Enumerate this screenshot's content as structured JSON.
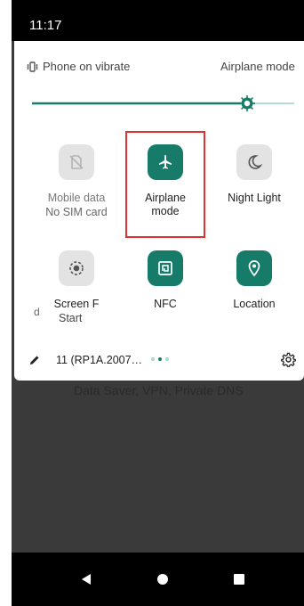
{
  "status_bar": {
    "time": "11:17"
  },
  "quick_settings": {
    "ringer_label": "Phone on vibrate",
    "airplane_header_label": "Airplane mode",
    "brightness_fraction": 0.82,
    "accent_color": "#167b68",
    "tiles": [
      {
        "label": "Mobile data",
        "sublabel": "No SIM card",
        "state": "off",
        "icon": "no-sim-icon"
      },
      {
        "label": "Airplane",
        "sublabel": "mode",
        "state": "on",
        "icon": "airplane-icon"
      },
      {
        "label": "Night Light",
        "sublabel": "",
        "state": "off",
        "icon": "moon-icon"
      },
      {
        "label": "Screen F",
        "sublabel": "Start",
        "state": "off",
        "icon": "screen-record-icon",
        "left_fragment": "d"
      },
      {
        "label": "NFC",
        "sublabel": "",
        "state": "on",
        "icon": "nfc-icon"
      },
      {
        "label": "Location",
        "sublabel": "",
        "state": "on",
        "icon": "location-pin-icon"
      }
    ],
    "footer": {
      "build": "11 (RP1A.2007…",
      "page_count": 3,
      "current_page": 2
    }
  },
  "background": {
    "text": "Data Saver, VPN, Private DNS"
  },
  "nav_bar": {
    "back": "back-icon",
    "home": "home-icon",
    "recents": "recents-icon"
  }
}
